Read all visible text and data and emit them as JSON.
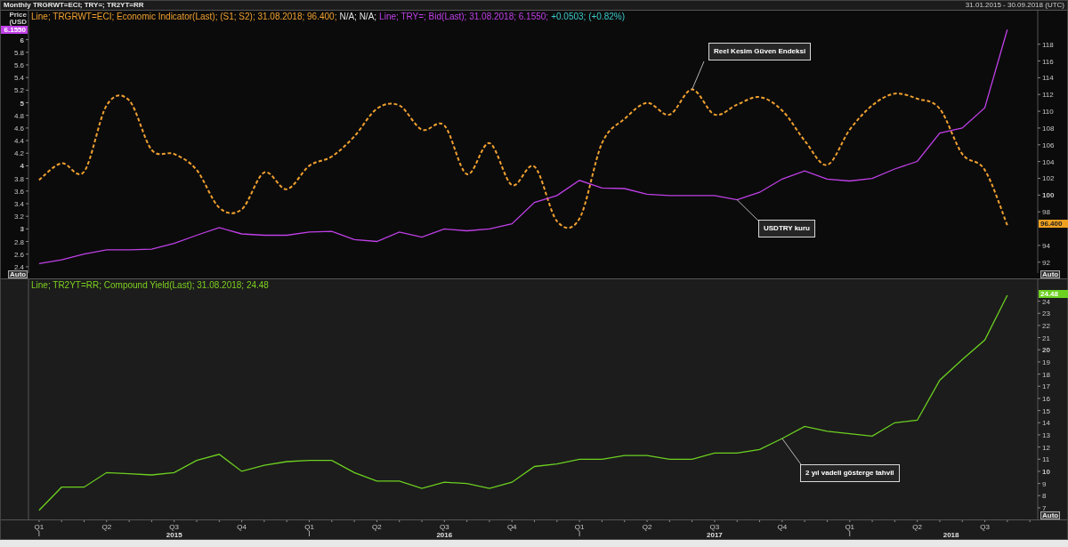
{
  "title": "Monthly TRGRWT=ECI; TRY=; TR2YT=RR",
  "date_range": "31.01.2015 - 30.09.2018 (UTC)",
  "panels": [
    {
      "axis_title": [
        "Price",
        "(USD"
      ],
      "legend": [
        {
          "text": "Line; TRGRWT=ECI; Economic Indicator(Last); (S1; S2); 31.08.2018; 96.400;",
          "color": "#f0a030"
        },
        {
          "text": "N/A; N/A;",
          "color": "#e0e0e0"
        },
        {
          "text": "Line; TRY=; Bid(Last); 31.08.2018; 6.1550;",
          "color": "#c040e8"
        },
        {
          "text": "+0.0503; (+0.82%)",
          "color": "#3cc8c8"
        }
      ],
      "auto_buttons": [
        "Auto",
        "Auto"
      ],
      "value_tags": [
        {
          "text": "96.400",
          "color": "#f0a020"
        },
        {
          "text": "6.1550",
          "color": "#c040e8"
        }
      ],
      "chart_data": {
        "type": "line",
        "categories": [
          null,
          null,
          null,
          null,
          null,
          null,
          null,
          null,
          null,
          null,
          null,
          null,
          null,
          null,
          null,
          null,
          null,
          null,
          null,
          null,
          null,
          null,
          null,
          null,
          null,
          null,
          null,
          null,
          null,
          null,
          null,
          null,
          null,
          null,
          null,
          null,
          null,
          null,
          null,
          null,
          null,
          null,
          null,
          null
        ],
        "ylim": [
          2.3,
          6.46
        ],
        "yticks": [
          2.4,
          2.6,
          2.8,
          3,
          3.2,
          3.4,
          3.6,
          3.8,
          4,
          4.2,
          4.4,
          4.6,
          4.8,
          5,
          5.2,
          5.4,
          5.6,
          5.8,
          6
        ],
        "y2lim": [
          90.7,
          122
        ],
        "y2ticks": [
          92,
          94,
          98,
          100,
          102,
          104,
          106,
          108,
          110,
          112,
          114,
          116,
          118
        ],
        "series": [
          {
            "color": "#f0a030",
            "axis": "y2",
            "line_style": "dashed",
            "values": [
              101.8,
              103.8,
              102.8,
              110.7,
              111.3,
              105.4,
              104.9,
              103,
              98.5,
              98.3,
              102.7,
              100.7,
              103.5,
              104.6,
              107,
              110.3,
              110.7,
              107.8,
              108.3,
              102.5,
              106.2,
              101.2,
              103.4,
              96.9,
              97.2,
              106.2,
              109.1,
              111,
              109.6,
              112.6,
              109.6,
              110.8,
              111.7,
              110.1,
              106.5,
              103.6,
              107.8,
              110.7,
              112.1,
              111.5,
              110.3,
              104.9,
              103,
              96.4
            ]
          },
          {
            "color": "#c040e8",
            "values": [
              2.45,
              2.51,
              2.6,
              2.67,
              2.67,
              2.68,
              2.77,
              2.9,
              3.02,
              2.92,
              2.9,
              2.9,
              2.95,
              2.96,
              2.83,
              2.8,
              2.95,
              2.87,
              3.0,
              2.97,
              3.0,
              3.08,
              3.42,
              3.53,
              3.77,
              3.65,
              3.64,
              3.55,
              3.53,
              3.53,
              3.53,
              3.46,
              3.58,
              3.79,
              3.92,
              3.79,
              3.76,
              3.8,
              3.95,
              4.07,
              4.52,
              4.6,
              4.92,
              6.16
            ]
          }
        ],
        "annotations": [
          "Reel Kesim Güven Endeksi",
          "USDTRY kuru"
        ]
      }
    },
    {
      "legend": [
        {
          "text": "Line; TR2YT=RR; Compound Yield(Last); 31.08.2018; 24.48",
          "color": "#7fd020"
        }
      ],
      "auto_buttons": [
        "Auto"
      ],
      "value_tags": [
        {
          "text": "24.48",
          "color": "#6cd020"
        }
      ],
      "year_labels": [
        "2015",
        "2016",
        "2017",
        "2018"
      ],
      "chart_data": {
        "type": "line",
        "categories": [
          "Q1",
          null,
          null,
          "Q2",
          null,
          null,
          "Q3",
          null,
          null,
          "Q4",
          null,
          null,
          "Q1",
          null,
          null,
          "Q2",
          null,
          null,
          "Q3",
          null,
          null,
          "Q4",
          null,
          null,
          "Q1",
          null,
          null,
          "Q2",
          null,
          null,
          "Q3",
          null,
          null,
          "Q4",
          null,
          null,
          "Q1",
          null,
          null,
          "Q2",
          null,
          null,
          "Q3",
          null
        ],
        "ylim": [
          5.97,
          25.8
        ],
        "yticks": [
          7,
          8,
          9,
          10,
          11,
          12,
          13,
          14,
          15,
          16,
          17,
          18,
          19,
          20,
          21,
          22,
          23,
          24
        ],
        "series": [
          {
            "color": "#6cd020",
            "values": [
              6.8,
              8.7,
              8.7,
              9.9,
              9.8,
              9.7,
              9.9,
              10.9,
              11.4,
              10,
              10.5,
              10.8,
              10.9,
              10.9,
              9.9,
              9.2,
              9.2,
              8.6,
              9.1,
              9.0,
              8.6,
              9.1,
              10.4,
              10.6,
              11,
              11,
              11.3,
              11.3,
              11,
              11,
              11.5,
              11.5,
              11.8,
              12.7,
              13.7,
              13.3,
              13.1,
              12.9,
              14,
              14.2,
              17.5,
              19.2,
              20.8,
              24.48
            ]
          }
        ],
        "annotations": [
          "2 yıl vadeli gösterge tahvil"
        ]
      }
    }
  ]
}
